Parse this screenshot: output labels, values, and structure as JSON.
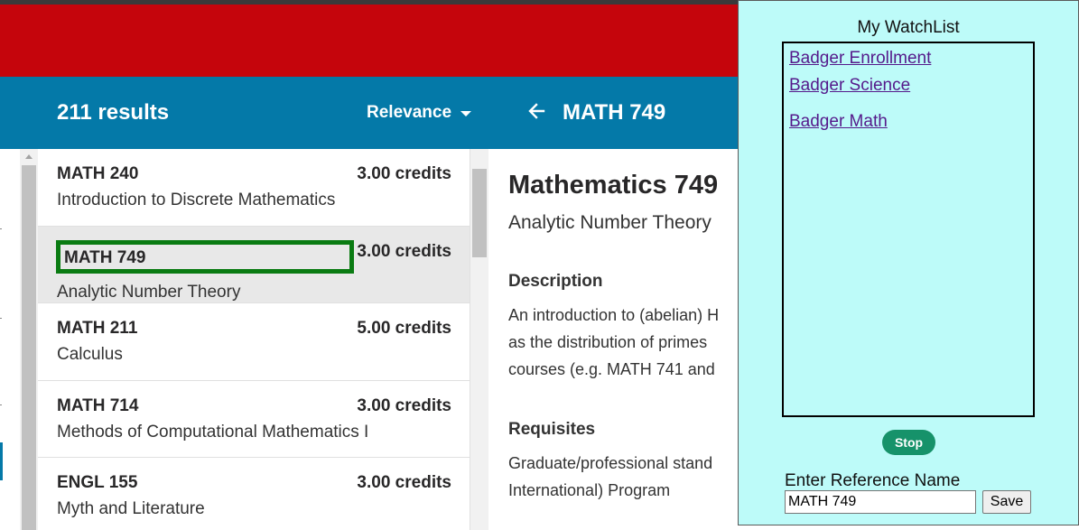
{
  "header": {
    "results_count": "211 results",
    "sort_label": "Relevance",
    "detail_course_code": "MATH 749"
  },
  "courses": [
    {
      "code": "MATH 240",
      "credits": "3.00 credits",
      "title": "Introduction to Discrete Mathematics"
    },
    {
      "code": "MATH 749",
      "credits": "3.00 credits",
      "title": "Analytic Number Theory"
    },
    {
      "code": "MATH 211",
      "credits": "5.00 credits",
      "title": "Calculus"
    },
    {
      "code": "MATH 714",
      "credits": "3.00 credits",
      "title": "Methods of Computational Mathematics I"
    },
    {
      "code": "ENGL 155",
      "credits": "3.00 credits",
      "title": "Myth and Literature"
    }
  ],
  "detail": {
    "title": "Mathematics 749",
    "subtitle": "Analytic Number Theory",
    "description_heading": "Description",
    "description_lines": [
      "An introduction to (abelian) H",
      "as the distribution of primes",
      "courses (e.g. MATH 741 and"
    ],
    "requisites_heading": "Requisites",
    "requisites_lines": [
      "Graduate/professional stand",
      "International) Program"
    ]
  },
  "watchlist": {
    "title": "My WatchList",
    "items": [
      "Badger Enrollment",
      "Badger Science",
      "Badger Math"
    ],
    "stop_label": "Stop",
    "reference_label": "Enter Reference Name",
    "reference_value": "MATH 749",
    "save_label": "Save"
  },
  "colors": {
    "top_bar": "#c5050c",
    "header_bar": "#0479a8",
    "selection_box": "#0a7b12",
    "watch_panel_bg": "#bdfbf9",
    "stop_button": "#16926a"
  },
  "icons": {
    "back": "arrow-left-icon",
    "sort": "caret-down-icon"
  }
}
